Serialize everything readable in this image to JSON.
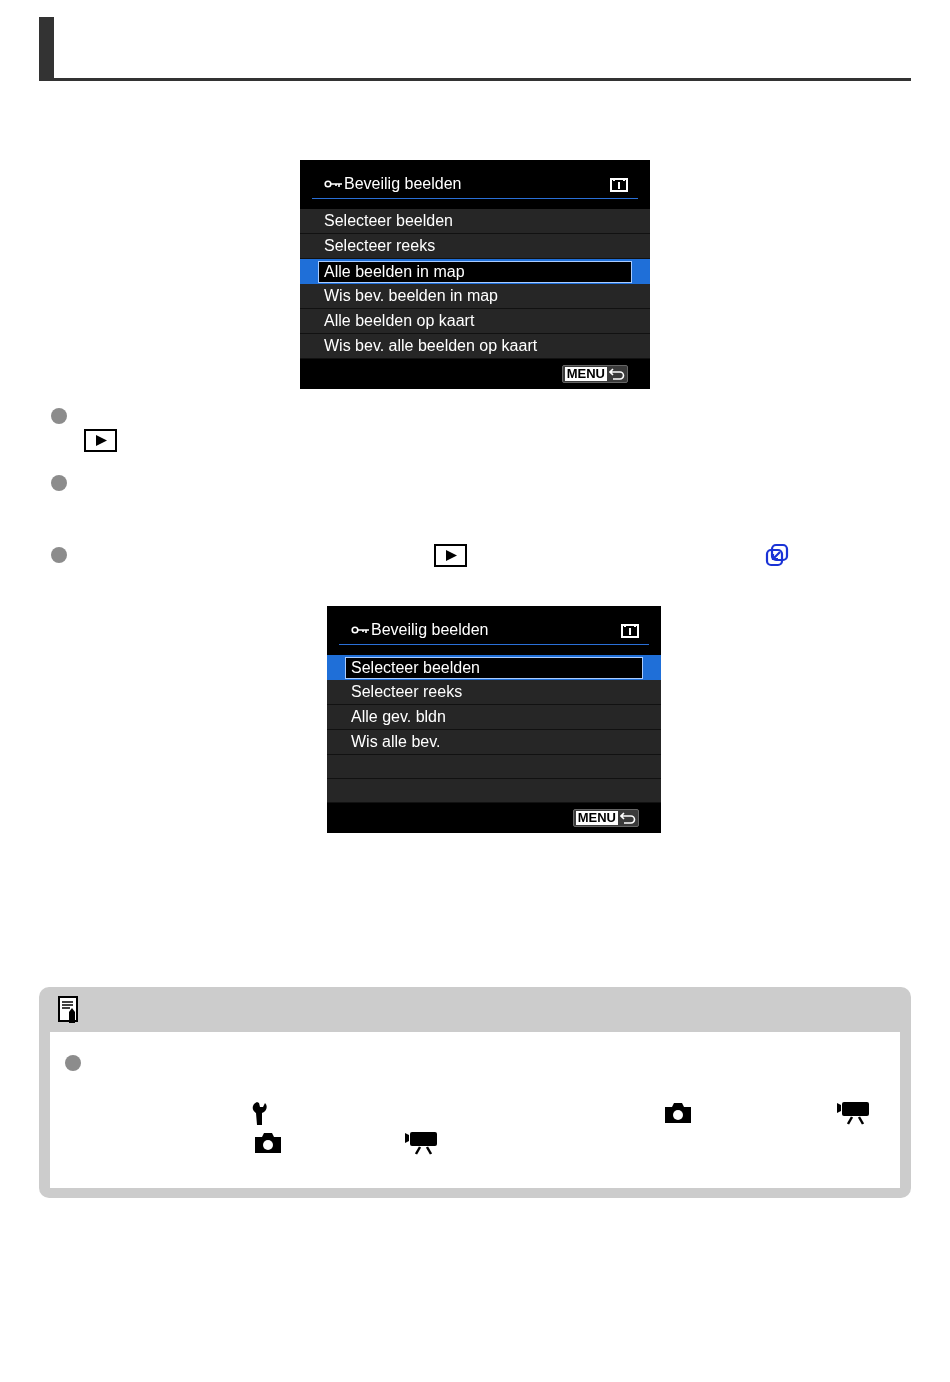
{
  "screens": [
    {
      "title": "Beveilig beelden",
      "items": [
        {
          "label": "Selecteer beelden",
          "selected": false
        },
        {
          "label": "Selecteer reeks",
          "selected": false
        },
        {
          "label": "Alle beelden in map",
          "selected": true
        },
        {
          "label": "Wis bev. beelden in map",
          "selected": false
        },
        {
          "label": "Alle beelden op kaart",
          "selected": false
        },
        {
          "label": "Wis bev. alle beelden op kaart",
          "selected": false
        }
      ],
      "menu_button": "MENU"
    },
    {
      "title": "Beveilig beelden",
      "items": [
        {
          "label": "Selecteer beelden",
          "selected": true
        },
        {
          "label": "Selecteer reeks",
          "selected": false
        },
        {
          "label": "Alle gev. bldn",
          "selected": false
        },
        {
          "label": "Wis alle bev.",
          "selected": false
        }
      ],
      "menu_button": "MENU"
    }
  ]
}
